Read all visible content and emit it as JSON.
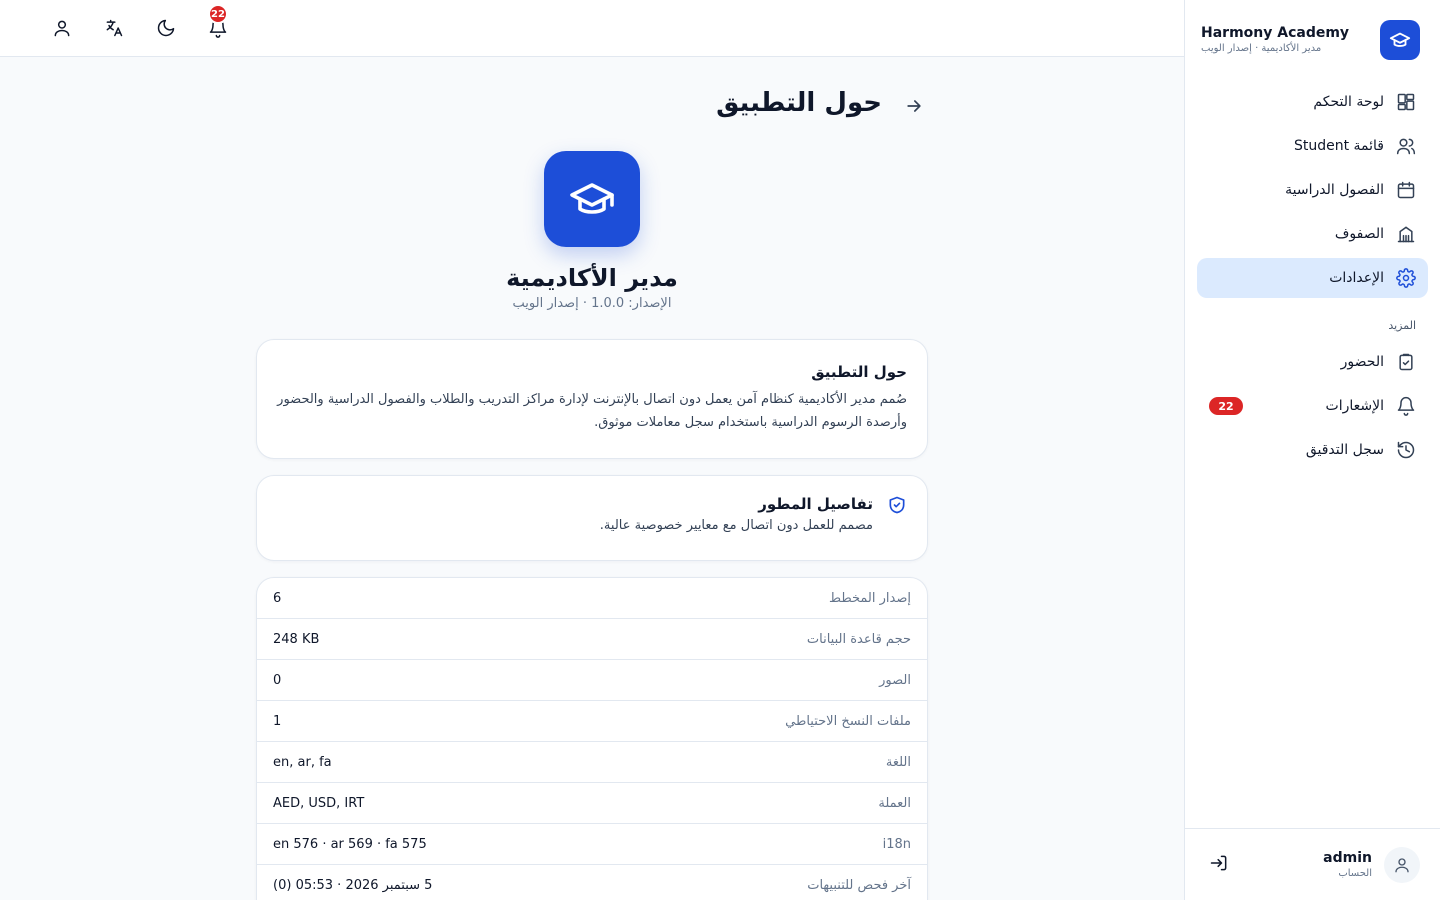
{
  "brand": {
    "name": "Harmony Academy",
    "subtitle": "مدير الأكاديمية · إصدار الويب"
  },
  "sidebar": {
    "items": [
      {
        "label": "لوحة التحكم",
        "icon": "dashboard-icon",
        "active": false
      },
      {
        "label": "قائمة Student",
        "icon": "users-icon",
        "active": false
      },
      {
        "label": "الفصول الدراسية",
        "icon": "calendar-icon",
        "active": false
      },
      {
        "label": "الصفوف",
        "icon": "building-icon",
        "active": false
      },
      {
        "label": "الإعدادات",
        "icon": "gear-icon",
        "active": true
      }
    ],
    "section_label": "المزيد",
    "more_items": [
      {
        "label": "الحضور",
        "icon": "clipboard-check-icon"
      },
      {
        "label": "الإشعارات",
        "icon": "bell-icon",
        "badge": "22"
      },
      {
        "label": "سجل التدقيق",
        "icon": "history-icon"
      }
    ]
  },
  "account": {
    "name": "admin",
    "role": "الحساب"
  },
  "topbar": {
    "notification_count": "22"
  },
  "page": {
    "title": "حول التطبيق"
  },
  "hero": {
    "app_name": "مدير الأكاديمية",
    "version": "الإصدار: 1.0.0 · إصدار الويب"
  },
  "about_card": {
    "title": "حول التطبيق",
    "body": "صُمم مدير الأكاديمية كنظام آمن يعمل دون اتصال بالإنترنت لإدارة مراكز التدريب والطلاب والفصول الدراسية والحضور وأرصدة الرسوم الدراسية باستخدام سجل معاملات موثوق."
  },
  "developer_card": {
    "title": "تفاصيل المطور",
    "subtitle": "مصمم للعمل دون اتصال مع معايير خصوصية عالية."
  },
  "details": [
    {
      "label": "إصدار المخطط",
      "value": "6"
    },
    {
      "label": "حجم قاعدة البيانات",
      "value": "248 KB"
    },
    {
      "label": "الصور",
      "value": "0"
    },
    {
      "label": "ملفات النسخ الاحتياطي",
      "value": "1"
    },
    {
      "label": "اللغة",
      "value": "en, ar, fa"
    },
    {
      "label": "العملة",
      "value": "AED, USD, IRT"
    },
    {
      "label": "i18n",
      "value": "en 576 · ar 569 · fa 575"
    },
    {
      "label": "آخر فحص للتنبيهات",
      "value": "5 سبتمبر 2026 · 05:53 (0)"
    }
  ]
}
